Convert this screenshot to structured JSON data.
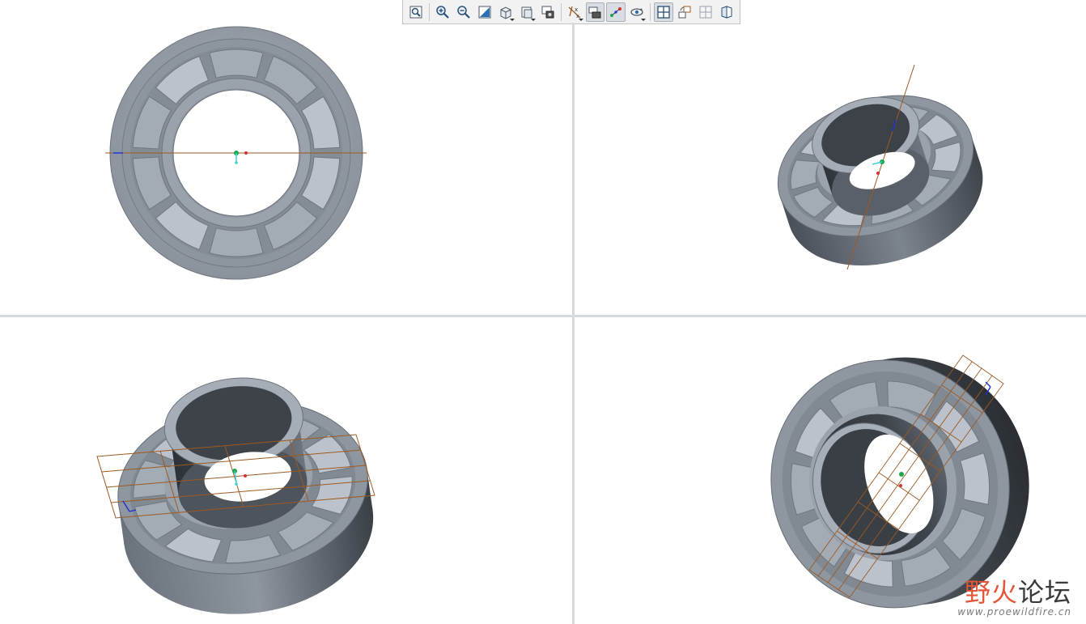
{
  "toolbar": {
    "buttons": [
      {
        "name": "refit-icon",
        "active": false,
        "dropdown": false
      },
      {
        "name": "zoom-in-icon",
        "active": false,
        "dropdown": false
      },
      {
        "name": "zoom-out-icon",
        "active": false,
        "dropdown": false
      },
      {
        "name": "repaint-icon",
        "active": false,
        "dropdown": false
      },
      {
        "name": "display-style-icon",
        "active": false,
        "dropdown": true
      },
      {
        "name": "saved-views-icon",
        "active": false,
        "dropdown": true
      },
      {
        "name": "view-manager-icon",
        "active": false,
        "dropdown": false
      },
      {
        "name": "datum-display-icon",
        "active": false,
        "dropdown": true
      },
      {
        "name": "plane-tag-icon",
        "active": true,
        "dropdown": false
      },
      {
        "name": "axis-display-icon",
        "active": true,
        "dropdown": false
      },
      {
        "name": "spin-center-icon",
        "active": false,
        "dropdown": true
      },
      {
        "name": "four-views-icon",
        "active": true,
        "dropdown": false
      },
      {
        "name": "orient-icon",
        "active": false,
        "dropdown": false
      },
      {
        "name": "layout-icon",
        "active": false,
        "dropdown": false
      },
      {
        "name": "section-icon",
        "active": false,
        "dropdown": false
      }
    ]
  },
  "views": [
    {
      "name": "front-view"
    },
    {
      "name": "isometric-view-top-right"
    },
    {
      "name": "isometric-view-bottom-left"
    },
    {
      "name": "isometric-view-bottom-right"
    }
  ],
  "colors": {
    "part_face": "#8c949e",
    "part_dark": "#3e4249",
    "part_light": "#c4cad3",
    "datum": "#9c5a23",
    "axis_blue": "#1d2fd6",
    "origin_green": "#1aa84a",
    "origin_red": "#d23232",
    "origin_cyan": "#3fd0dc"
  },
  "watermark": {
    "title_a": "野火",
    "title_b": "论坛",
    "url": "www.proewildfire.cn"
  }
}
